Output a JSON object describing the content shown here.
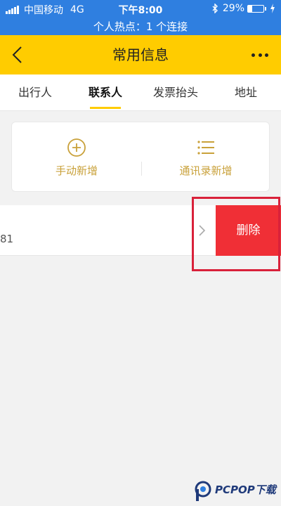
{
  "status_bar": {
    "carrier": "中国移动",
    "network": "4G",
    "time": "下午8:00",
    "battery_text": "29%",
    "battery_level": 0.29,
    "hotspot": "个人热点：1 个连接"
  },
  "navbar": {
    "title": "常用信息"
  },
  "tabs": [
    {
      "label": "出行人",
      "active": false
    },
    {
      "label": "联系人",
      "active": true
    },
    {
      "label": "发票抬头",
      "active": false
    },
    {
      "label": "地址",
      "active": false
    }
  ],
  "add_options": {
    "manual": "手动新增",
    "contacts": "通讯录新增"
  },
  "contact": {
    "phone_partial": "81",
    "delete_label": "删除"
  },
  "watermark": {
    "text": "PCPOP下载"
  },
  "colors": {
    "status_blue": "#2f7fe0",
    "brand_yellow": "#ffcc00",
    "gold_text": "#c9a13a",
    "delete_red": "#f02f36",
    "highlight_red": "#d9213a"
  }
}
